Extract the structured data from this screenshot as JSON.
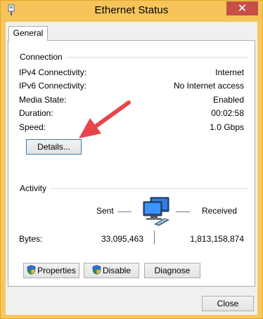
{
  "window": {
    "title": "Ethernet Status",
    "close_glyph": "✕"
  },
  "tabs": [
    {
      "label": "General",
      "selected": true
    }
  ],
  "connection": {
    "heading": "Connection",
    "rows": [
      {
        "label": "IPv4 Connectivity:",
        "value": "Internet"
      },
      {
        "label": "IPv6 Connectivity:",
        "value": "No Internet access"
      },
      {
        "label": "Media State:",
        "value": "Enabled"
      },
      {
        "label": "Duration:",
        "value": "00:02:58"
      },
      {
        "label": "Speed:",
        "value": "1.0 Gbps"
      }
    ],
    "details_button": "Details..."
  },
  "activity": {
    "heading": "Activity",
    "sent_label": "Sent",
    "received_label": "Received",
    "bytes_label": "Bytes:",
    "bytes_sent": "33,095,463",
    "bytes_received": "1,813,158,874",
    "icon": "network-computers-icon"
  },
  "buttons": {
    "properties": "Properties",
    "disable": "Disable",
    "diagnose": "Diagnose",
    "close": "Close"
  },
  "colors": {
    "title_bar": "#f6c45a",
    "annotation_arrow": "#e8454b",
    "close_button": "#c74f48"
  }
}
